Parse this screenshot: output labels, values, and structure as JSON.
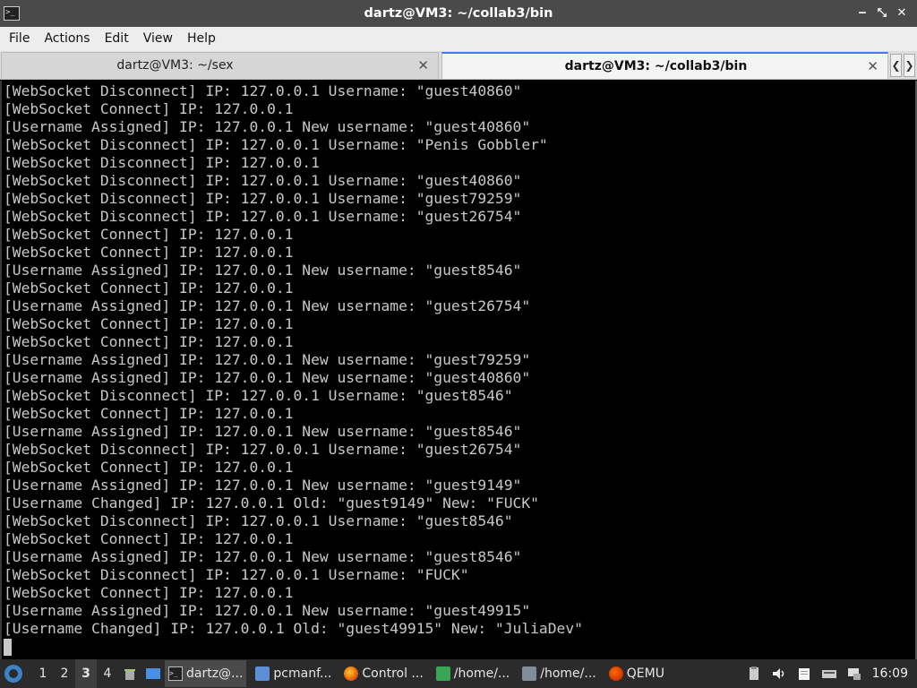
{
  "window": {
    "title": "dartz@VM3: ~/collab3/bin",
    "app_icon_text": ">_",
    "minimize_glyph": "‒",
    "maximize_glyph": "⤡",
    "close_glyph": "✕"
  },
  "menu": [
    "File",
    "Actions",
    "Edit",
    "View",
    "Help"
  ],
  "tabs": [
    {
      "label": "dartz@VM3: ~/sex",
      "active": false
    },
    {
      "label": "dartz@VM3: ~/collab3/bin",
      "active": true
    }
  ],
  "tab_close_glyph": "✕",
  "tab_scroll": {
    "left": "❮",
    "right": "❯"
  },
  "terminal": {
    "lines": [
      "[WebSocket Disconnect] IP: 127.0.0.1 Username: \"guest40860\"",
      "[WebSocket Connect] IP: 127.0.0.1",
      "[Username Assigned] IP: 127.0.0.1 New username: \"guest40860\"",
      "[WebSocket Disconnect] IP: 127.0.0.1 Username: \"Penis Gobbler\"",
      "[WebSocket Disconnect] IP: 127.0.0.1",
      "[WebSocket Disconnect] IP: 127.0.0.1 Username: \"guest40860\"",
      "[WebSocket Disconnect] IP: 127.0.0.1 Username: \"guest79259\"",
      "[WebSocket Disconnect] IP: 127.0.0.1 Username: \"guest26754\"",
      "[WebSocket Connect] IP: 127.0.0.1",
      "[WebSocket Connect] IP: 127.0.0.1",
      "[Username Assigned] IP: 127.0.0.1 New username: \"guest8546\"",
      "[WebSocket Connect] IP: 127.0.0.1",
      "[Username Assigned] IP: 127.0.0.1 New username: \"guest26754\"",
      "[WebSocket Connect] IP: 127.0.0.1",
      "[WebSocket Connect] IP: 127.0.0.1",
      "[Username Assigned] IP: 127.0.0.1 New username: \"guest79259\"",
      "[Username Assigned] IP: 127.0.0.1 New username: \"guest40860\"",
      "[WebSocket Disconnect] IP: 127.0.0.1 Username: \"guest8546\"",
      "[WebSocket Connect] IP: 127.0.0.1",
      "[Username Assigned] IP: 127.0.0.1 New username: \"guest8546\"",
      "[WebSocket Disconnect] IP: 127.0.0.1 Username: \"guest26754\"",
      "[WebSocket Connect] IP: 127.0.0.1",
      "[Username Assigned] IP: 127.0.0.1 New username: \"guest9149\"",
      "[Username Changed] IP: 127.0.0.1 Old: \"guest9149\" New: \"FUCK\"",
      "[WebSocket Disconnect] IP: 127.0.0.1 Username: \"guest8546\"",
      "[WebSocket Connect] IP: 127.0.0.1",
      "[Username Assigned] IP: 127.0.0.1 New username: \"guest8546\"",
      "[WebSocket Disconnect] IP: 127.0.0.1 Username: \"FUCK\"",
      "[WebSocket Connect] IP: 127.0.0.1",
      "[Username Assigned] IP: 127.0.0.1 New username: \"guest49915\"",
      "[Username Changed] IP: 127.0.0.1 Old: \"guest49915\" New: \"JuliaDev\""
    ]
  },
  "taskbar": {
    "desktops": [
      "1",
      "2",
      "3",
      "4"
    ],
    "current_desktop": "3",
    "tasks": [
      {
        "label": "dartz@...",
        "icon": "terminal-icon",
        "active": true
      },
      {
        "label": "pcmanf...",
        "icon": "folder-icon",
        "active": false
      },
      {
        "label": "Control ...",
        "icon": "firefox-icon",
        "active": false
      },
      {
        "label": "/home/...",
        "icon": "text-editor-icon",
        "active": false
      },
      {
        "label": "/home/...",
        "icon": "feather-icon",
        "active": false
      },
      {
        "label": "QEMU",
        "icon": "qemu-icon",
        "active": false
      }
    ],
    "clock": "16:09"
  }
}
